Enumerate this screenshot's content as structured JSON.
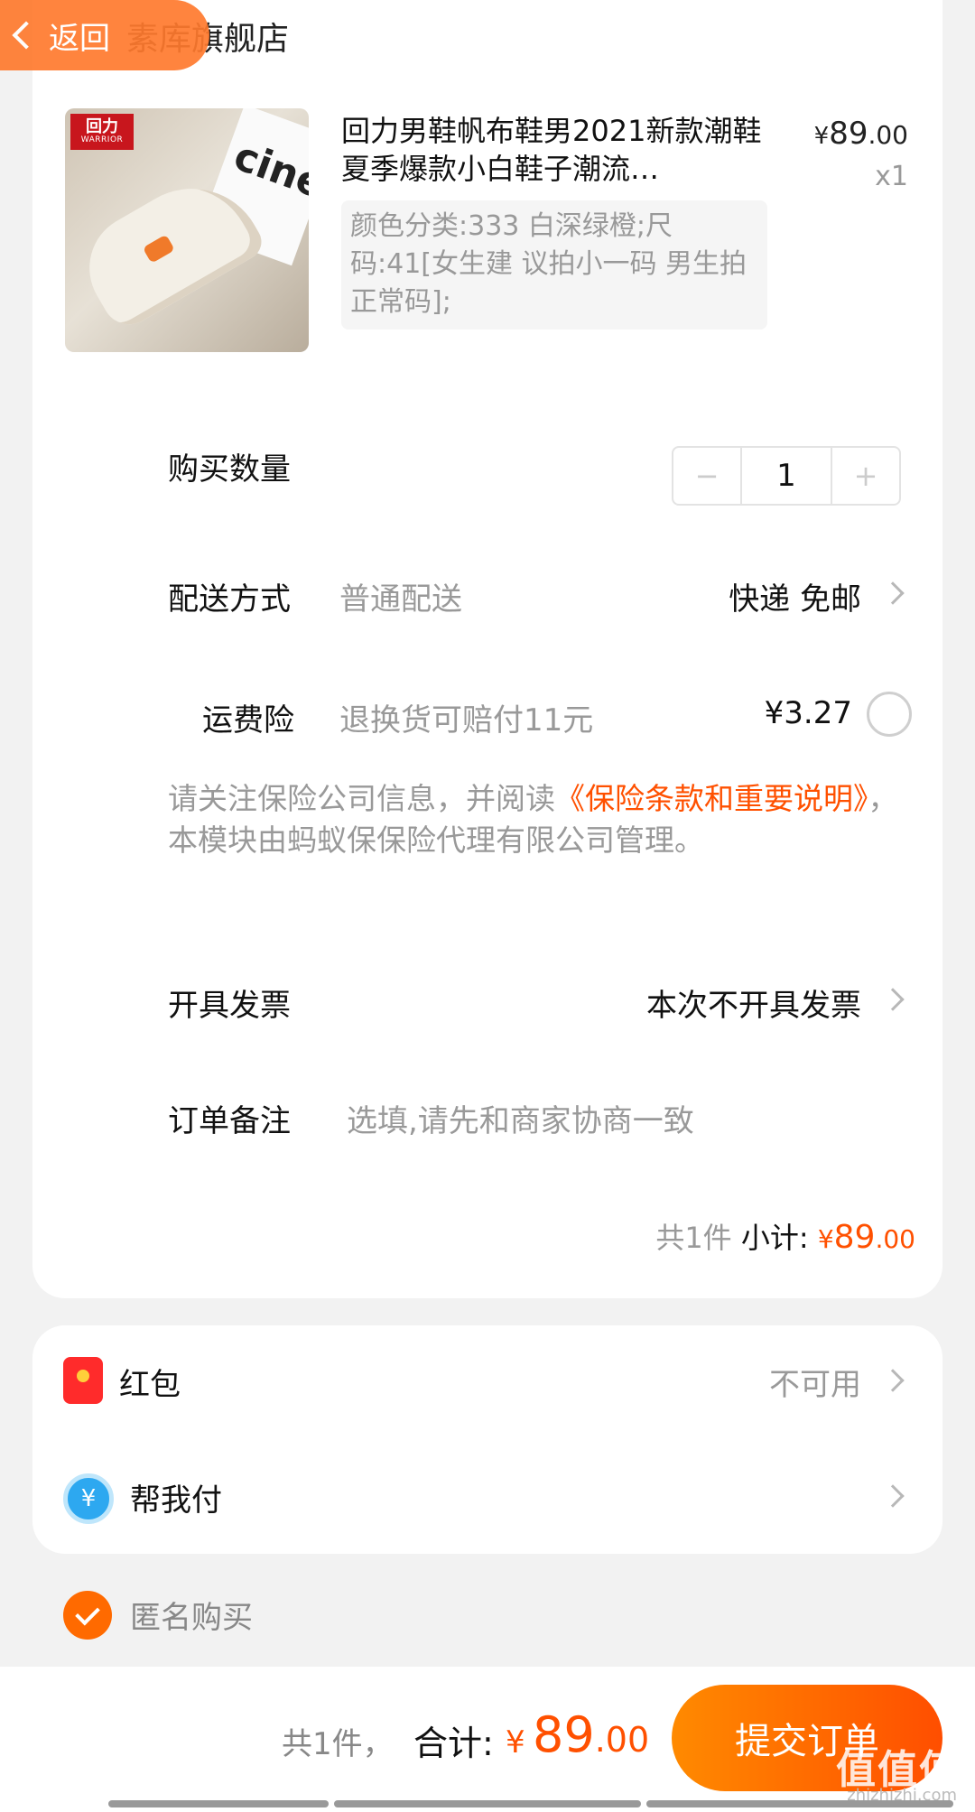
{
  "header": {
    "back_label": "返回",
    "store_name": "素库旗舰店"
  },
  "product": {
    "brand_badge": "回力",
    "brand_badge_sub": "WARRIOR",
    "box_text": "cine",
    "title": "回力男鞋帆布鞋男2021新款潮鞋夏季爆款小白鞋子潮流…",
    "price_yen": "¥",
    "price_int": "89",
    "price_dec": ".00",
    "quantity": "x1",
    "sku": "颜色分类:333 白深绿橙;尺码:41[女生建 议拍小一码 男生拍正常码];"
  },
  "purchase_qty": {
    "label": "购买数量",
    "minus": "−",
    "value": "1",
    "plus": "+"
  },
  "delivery": {
    "label": "配送方式",
    "hint": "普通配送",
    "value": "快递 免邮"
  },
  "shipping_insurance": {
    "label": "运费险",
    "hint": "退换货可赔付11元",
    "price": "¥3.27"
  },
  "notice": {
    "prefix": "请关注保险公司信息，并阅读",
    "link": "《保险条款和重要说明》",
    "suffix": "，本模块由蚂蚁保保险代理有限公司管理。"
  },
  "invoice": {
    "label": "开具发票",
    "value": "本次不开具发票"
  },
  "remark": {
    "label": "订单备注",
    "placeholder": "选填,请先和商家协商一致"
  },
  "subtotal": {
    "count": "共1件",
    "label": "小计:",
    "yen": "¥",
    "int": "89",
    "dec": ".00"
  },
  "red_packet": {
    "label": "红包",
    "value": "不可用"
  },
  "help_pay": {
    "label": "帮我付",
    "icon_text": "¥"
  },
  "anonymous": {
    "label": "匿名购买",
    "checked": true
  },
  "footer": {
    "count": "共1件，",
    "total_label": "合计:",
    "yen": "¥",
    "int": "89",
    "dec": ".00",
    "submit_label": "提交订单",
    "watermark": "值值值",
    "watermark_site": "zhizhizhi.com"
  },
  "colors": {
    "accent": "#ff5000",
    "submit_gradient_start": "#ff8a00",
    "submit_gradient_end": "#ff4e00"
  }
}
